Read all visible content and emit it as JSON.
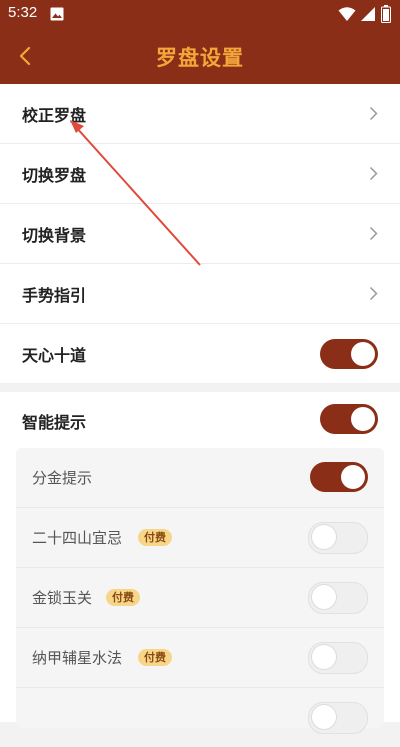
{
  "status_bar": {
    "time": "5:32"
  },
  "header": {
    "title": "罗盘设置"
  },
  "settings": [
    {
      "label": "校正罗盘"
    },
    {
      "label": "切换罗盘"
    },
    {
      "label": "切换背景"
    },
    {
      "label": "手势指引"
    },
    {
      "label": "天心十道",
      "toggle": "on"
    }
  ],
  "smart_tip": {
    "label": "智能提示",
    "toggle": "on",
    "items": [
      {
        "label": "分金提示",
        "toggle": "on"
      },
      {
        "label": "二十四山宜忌",
        "badge": "付费",
        "toggle": "off"
      },
      {
        "label": "金锁玉关",
        "badge": "付费",
        "toggle": "off"
      },
      {
        "label": "纳甲辅星水法",
        "badge": "付费",
        "toggle": "off"
      }
    ]
  },
  "colors": {
    "brand": "#8b2e17",
    "title": "#f4a63a",
    "badge": "#f7d68a",
    "arrow": "#e04a3a"
  }
}
